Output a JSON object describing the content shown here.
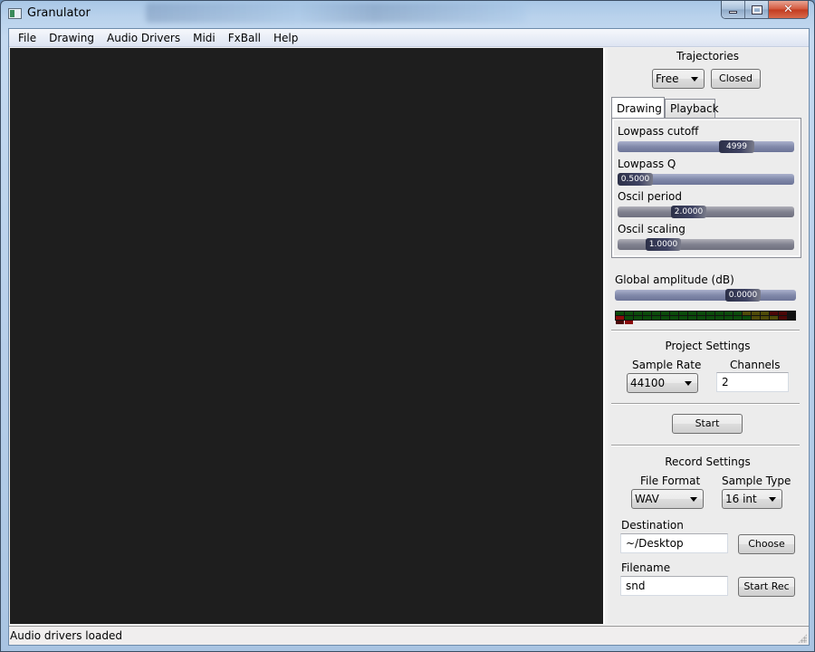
{
  "window": {
    "title": "Granulator",
    "controls": {
      "minimize": "minimize-icon",
      "maximize": "maximize-icon",
      "close": "close-icon"
    }
  },
  "menubar": {
    "items": [
      "File",
      "Drawing",
      "Audio Drivers",
      "Midi",
      "FxBall",
      "Help"
    ]
  },
  "trajectories": {
    "heading": "Trajectories",
    "mode_selected": "Free",
    "closed_button": "Closed"
  },
  "tabs": [
    {
      "label": "Drawing",
      "active": true
    },
    {
      "label": "Playback",
      "active": false
    }
  ],
  "drawing_controls": [
    {
      "label": "Lowpass cutoff",
      "value_text": "4999",
      "position_fraction": 0.72
    },
    {
      "label": "Lowpass Q",
      "value_text": "0.5000",
      "position_fraction": 0.0
    },
    {
      "label": "Oscil period",
      "value_text": "2.0000",
      "position_fraction": 0.38
    },
    {
      "label": "Oscil scaling",
      "value_text": "1.0000",
      "position_fraction": 0.2
    }
  ],
  "global_amplitude": {
    "label": "Global amplitude (dB)",
    "value_text": "0.0000",
    "position_fraction": 0.76
  },
  "vu_meter": {
    "segments_per_row": 20,
    "rows": 2,
    "green_count": 14,
    "yellow_count": 3,
    "red_count": 3,
    "colors": {
      "green": "#0a4a0a",
      "yellow": "#4e4a08",
      "red": "#4a0606",
      "red_peak": "#8a0a0a"
    }
  },
  "project_settings": {
    "heading": "Project Settings",
    "sample_rate_label": "Sample Rate",
    "sample_rate_value": "44100",
    "channels_label": "Channels",
    "channels_value": "2",
    "start_button": "Start"
  },
  "record_settings": {
    "heading": "Record Settings",
    "file_format_label": "File Format",
    "file_format_value": "WAV",
    "sample_type_label": "Sample Type",
    "sample_type_value": "16 int",
    "destination_label": "Destination",
    "destination_value": "~/Desktop",
    "choose_button": "Choose",
    "filename_label": "Filename",
    "filename_value": "snd",
    "start_rec_button": "Start Rec"
  },
  "statusbar": {
    "message": "Audio drivers loaded"
  },
  "colors": {
    "canvas_bg": "#1e1e1e",
    "panel_bg": "#ececec"
  }
}
